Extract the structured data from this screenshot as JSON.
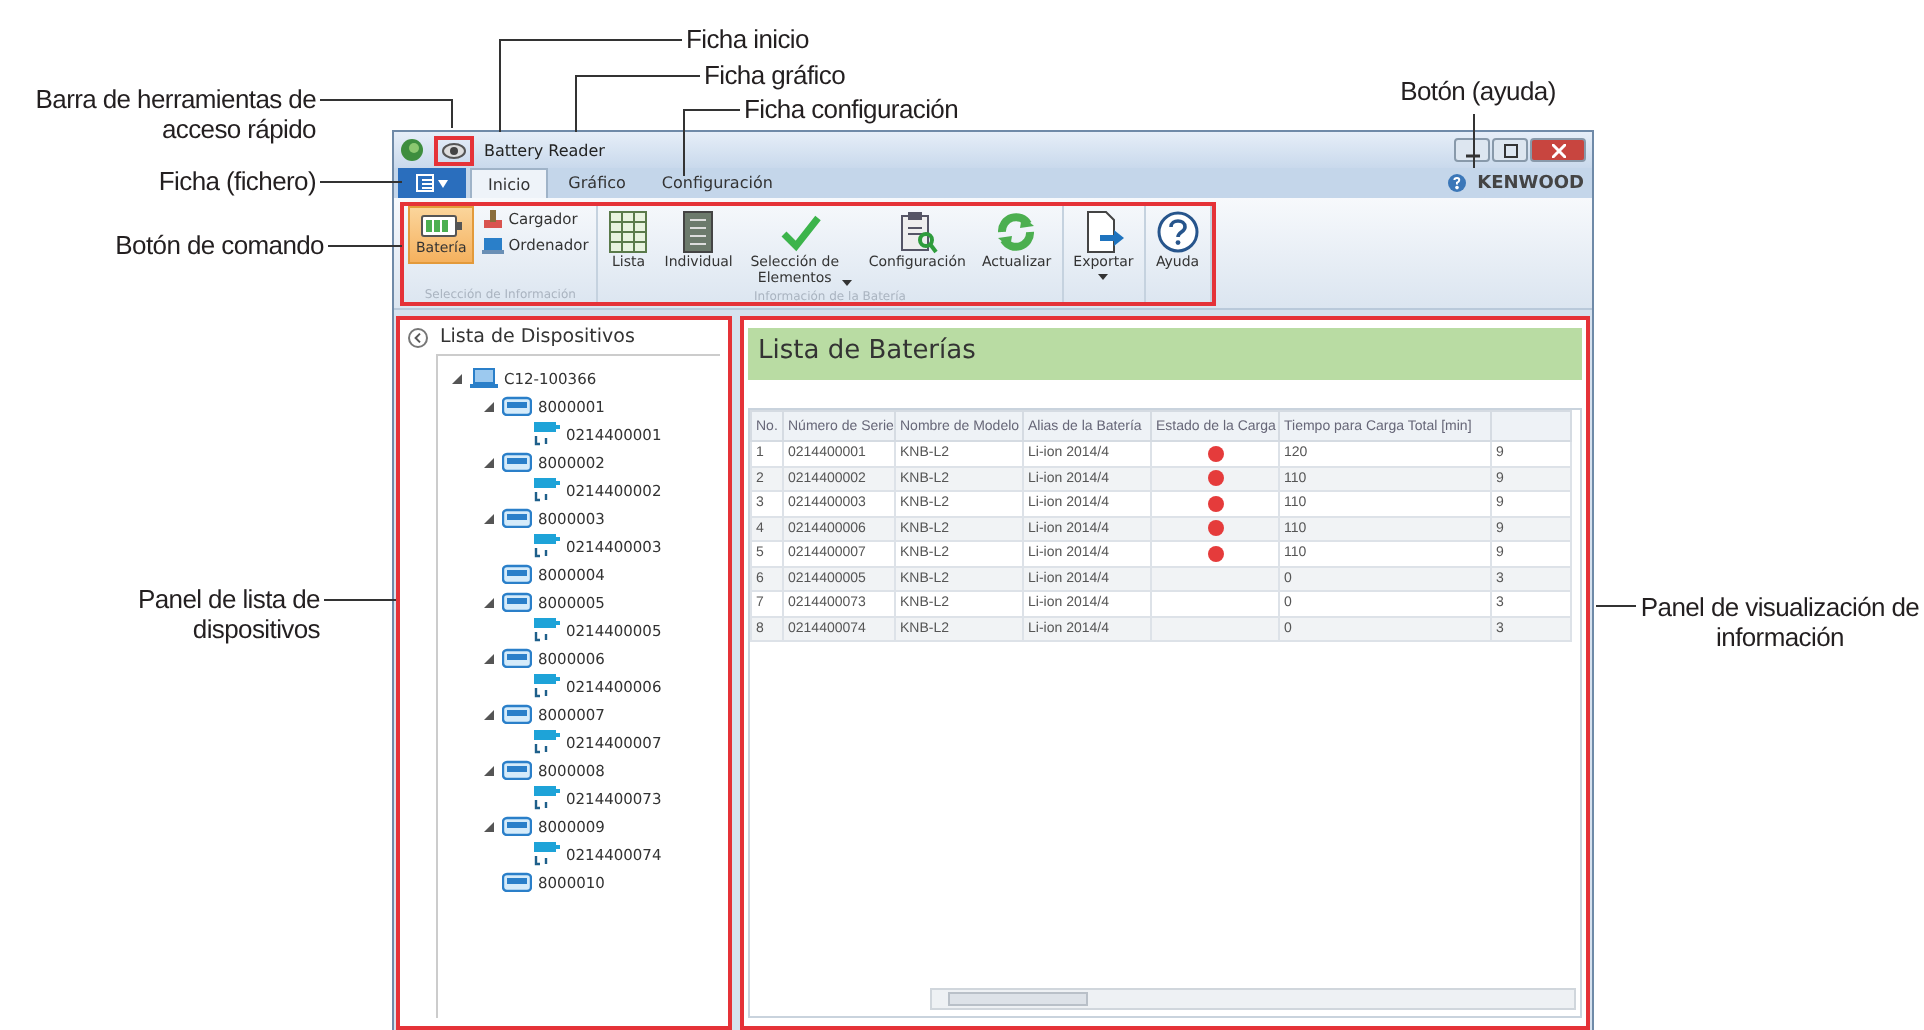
{
  "callouts": [
    {
      "text": "Ficha inicio"
    },
    {
      "text": "Ficha gráfico"
    },
    {
      "text": "Ficha configuración"
    },
    {
      "text": "Botón (ayuda)"
    },
    {
      "text": "Barra de herramientas de acceso rápido"
    },
    {
      "text": "Ficha (fichero)"
    },
    {
      "text": "Botón de comando"
    },
    {
      "text": "Panel de lista de dispositivos"
    },
    {
      "text": "Panel de visualización de información"
    }
  ],
  "window": {
    "title": "Battery Reader",
    "tabs": [
      {
        "label": "Inicio",
        "selected": true
      },
      {
        "label": "Gráfico",
        "selected": false
      },
      {
        "label": "Configuración",
        "selected": false
      }
    ],
    "brand": "KENWOOD",
    "ribbon": [
      {
        "label": "Selección de Información",
        "buttons": [
          {
            "label": "Batería",
            "kind": "large",
            "selected": true
          },
          {
            "label": "Cargador",
            "kind": "small",
            "selected": false
          },
          {
            "label": "Ordenador",
            "kind": "small",
            "selected": false
          }
        ]
      },
      {
        "label": "Información de la Batería",
        "buttons": [
          {
            "label": "Lista",
            "kind": "large",
            "selected": false
          },
          {
            "label": "Individual",
            "kind": "large",
            "selected": false
          },
          {
            "label": "Selección de Elementos",
            "kind": "dropdown",
            "selected": false
          },
          {
            "label": "Configuración",
            "kind": "large",
            "selected": false
          },
          {
            "label": "Actualizar",
            "kind": "large",
            "selected": false
          }
        ]
      },
      {
        "buttons": [
          {
            "label": "Exportar",
            "kind": "dropdown",
            "selected": false
          }
        ]
      },
      {
        "buttons": [
          {
            "label": "Ayuda",
            "kind": "large",
            "selected": false
          }
        ]
      }
    ]
  },
  "device_panel": {
    "title": "Lista de Dispositivos",
    "tree": [
      {
        "label": "C12-100366",
        "kind": "computer",
        "expanded": true,
        "children": [
          {
            "label": "8000001",
            "kind": "charger",
            "expanded": true,
            "children": [
              {
                "label": "0214400001",
                "kind": "battery"
              }
            ]
          },
          {
            "label": "8000002",
            "kind": "charger",
            "expanded": true,
            "children": [
              {
                "label": "0214400002",
                "kind": "battery"
              }
            ]
          },
          {
            "label": "8000003",
            "kind": "charger",
            "expanded": true,
            "children": [
              {
                "label": "0214400003",
                "kind": "battery"
              }
            ]
          },
          {
            "label": "8000004",
            "kind": "charger",
            "expanded": false
          },
          {
            "label": "8000005",
            "kind": "charger",
            "expanded": true,
            "children": [
              {
                "label": "0214400005",
                "kind": "battery"
              }
            ]
          },
          {
            "label": "8000006",
            "kind": "charger",
            "expanded": true,
            "children": [
              {
                "label": "0214400006",
                "kind": "battery"
              }
            ]
          },
          {
            "label": "8000007",
            "kind": "charger",
            "expanded": true,
            "children": [
              {
                "label": "0214400007",
                "kind": "battery"
              }
            ]
          },
          {
            "label": "8000008",
            "kind": "charger",
            "expanded": true,
            "children": [
              {
                "label": "0214400073",
                "kind": "battery"
              }
            ]
          },
          {
            "label": "8000009",
            "kind": "charger",
            "expanded": true,
            "children": [
              {
                "label": "0214400074",
                "kind": "battery"
              }
            ]
          },
          {
            "label": "8000010",
            "kind": "charger",
            "expanded": false
          }
        ]
      }
    ]
  },
  "info_panel": {
    "title": "Lista de Baterías",
    "columns": [
      "No.",
      "Número de Serie",
      "Nombre de Modelo",
      "Alias de la Batería",
      "Estado de la Carga",
      "Tiempo para Carga Total [min]"
    ],
    "rows": [
      {
        "no": "1",
        "serial_number": "0214400001",
        "model_name": "KNB-L2",
        "alias": "Li-ion 2014/4",
        "charging": true,
        "charge_time": "120",
        "column_7": "9"
      },
      {
        "no": "2",
        "serial_number": "0214400002",
        "model_name": "KNB-L2",
        "alias": "Li-ion 2014/4",
        "charging": true,
        "charge_time": "110",
        "column_7": "9"
      },
      {
        "no": "3",
        "serial_number": "0214400003",
        "model_name": "KNB-L2",
        "alias": "Li-ion 2014/4",
        "charging": true,
        "charge_time": "110",
        "column_7": "9"
      },
      {
        "no": "4",
        "serial_number": "0214400006",
        "model_name": "KNB-L2",
        "alias": "Li-ion 2014/4",
        "charging": true,
        "charge_time": "110",
        "column_7": "9"
      },
      {
        "no": "5",
        "serial_number": "0214400007",
        "model_name": "KNB-L2",
        "alias": "Li-ion 2014/4",
        "charging": true,
        "charge_time": "110",
        "column_7": "9"
      },
      {
        "no": "6",
        "serial_number": "0214400005",
        "model_name": "KNB-L2",
        "alias": "Li-ion 2014/4",
        "charging": false,
        "charge_time": "0",
        "column_7": "3"
      },
      {
        "no": "7",
        "serial_number": "0214400073",
        "model_name": "KNB-L2",
        "alias": "Li-ion 2014/4",
        "charging": false,
        "charge_time": "0",
        "column_7": "3"
      },
      {
        "no": "8",
        "serial_number": "0214400074",
        "model_name": "KNB-L2",
        "alias": "Li-ion 2014/4",
        "charging": false,
        "charge_time": "0",
        "column_7": "3"
      }
    ]
  }
}
